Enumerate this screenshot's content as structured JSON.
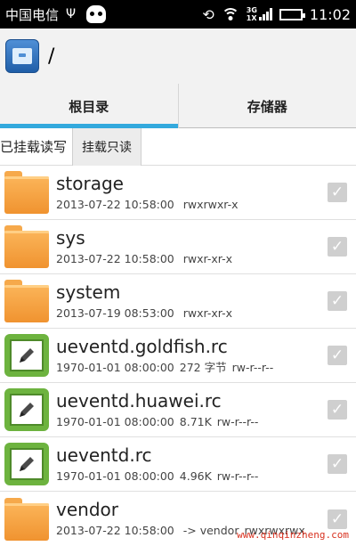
{
  "statusbar": {
    "carrier": "中国电信",
    "network_top": "3G",
    "network_bottom": "1X",
    "time": "11:02"
  },
  "titlebar": {
    "path": "/"
  },
  "tabs": [
    {
      "label": "根目录",
      "active": true
    },
    {
      "label": "存储器",
      "active": false
    }
  ],
  "mount": {
    "status": "已挂载读写",
    "button": "挂载只读"
  },
  "files": [
    {
      "name": "storage",
      "date": "2013-07-22 10:58:00",
      "size": "",
      "perm": "rwxrwxr-x",
      "type": "folder"
    },
    {
      "name": "sys",
      "date": "2013-07-22 10:58:00",
      "size": "",
      "perm": "rwxr-xr-x",
      "type": "folder"
    },
    {
      "name": "system",
      "date": "2013-07-19 08:53:00",
      "size": "",
      "perm": "rwxr-xr-x",
      "type": "folder"
    },
    {
      "name": "ueventd.goldfish.rc",
      "date": "1970-01-01 08:00:00",
      "size": "272 字节",
      "perm": "rw-r--r--",
      "type": "file"
    },
    {
      "name": "ueventd.huawei.rc",
      "date": "1970-01-01 08:00:00",
      "size": "8.71K",
      "perm": "rw-r--r--",
      "type": "file"
    },
    {
      "name": "ueventd.rc",
      "date": "1970-01-01 08:00:00",
      "size": "4.96K",
      "perm": "rw-r--r--",
      "type": "file"
    },
    {
      "name": "vendor",
      "date": "2013-07-22 10:58:00",
      "size": "-> vendor",
      "perm": "rwxrwxrwx",
      "type": "folder"
    }
  ],
  "watermark": "www.qinqinzheng.com",
  "colors": {
    "accent": "#33a9dd",
    "folder": "#f6a94b",
    "file_icon": "#6db33f"
  }
}
